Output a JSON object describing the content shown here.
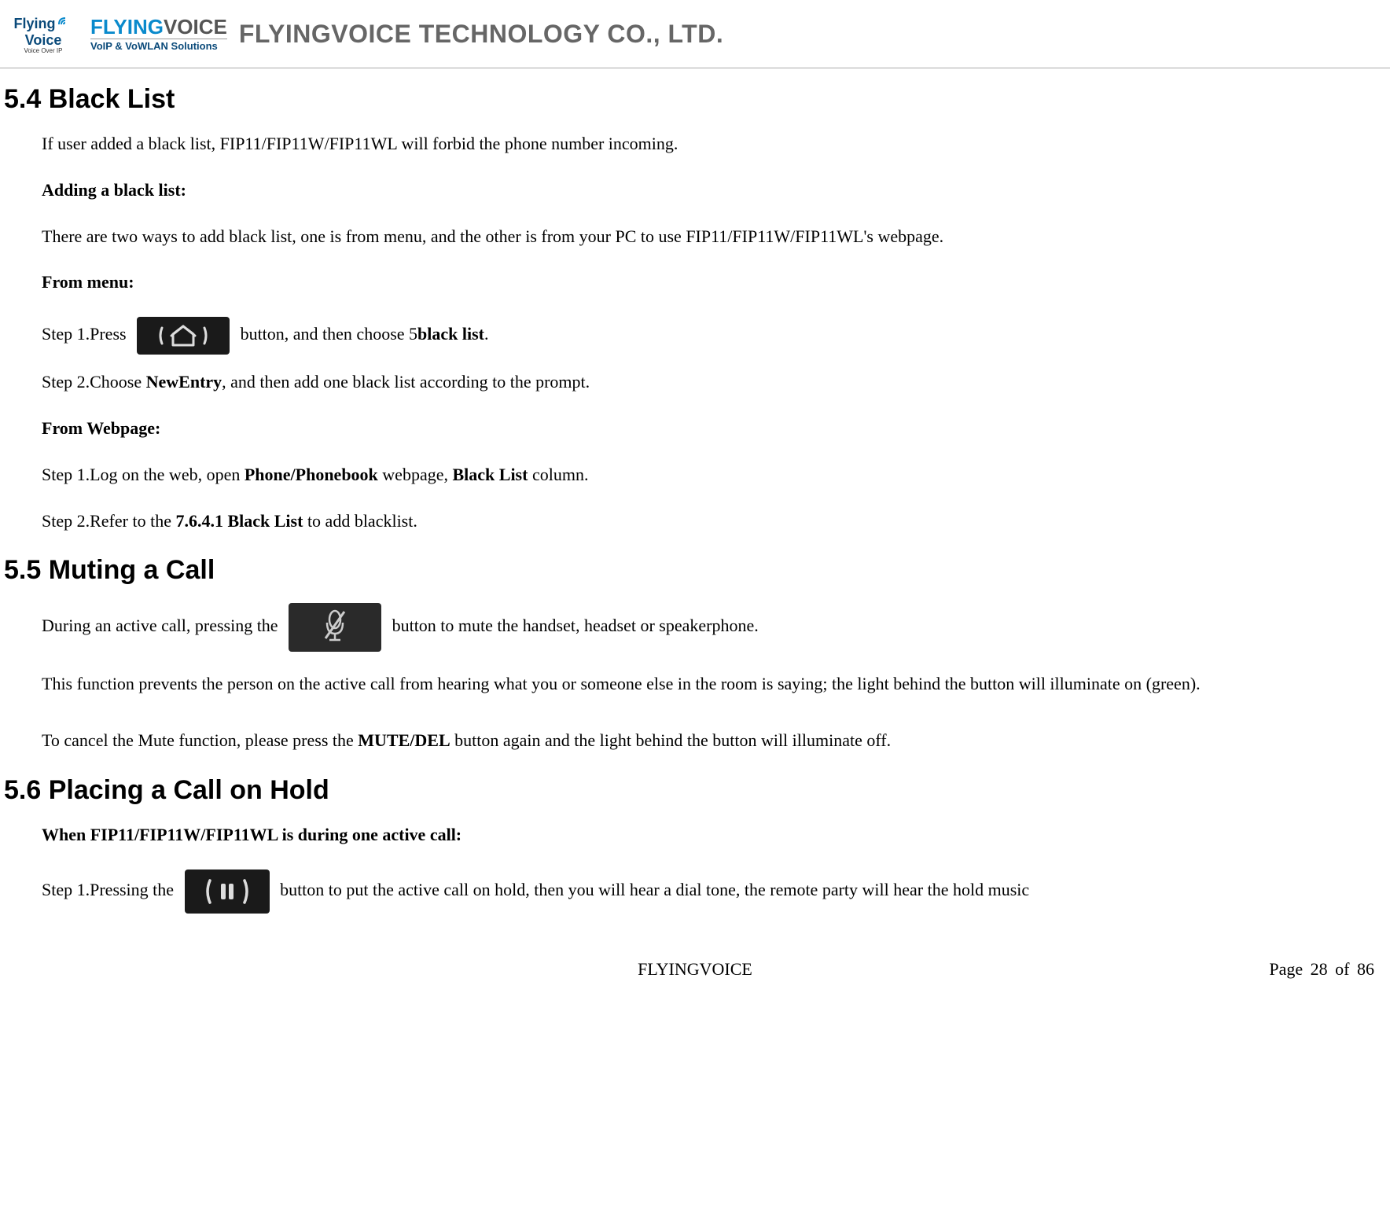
{
  "header": {
    "logo_small": {
      "line1": "Flying",
      "line2": "Voice",
      "tag": "Voice Over IP"
    },
    "logo_main": {
      "part1": "FLYING",
      "part2": "VOICE",
      "sub": "VoIP & VoWLAN Solutions"
    },
    "company": "FLYINGVOICE TECHNOLOGY CO., LTD."
  },
  "s54": {
    "title": "5.4   Black List",
    "p1": "If user added a black list, FIP11/FIP11W/FIP11WL will forbid the phone number incoming.",
    "p2": "Adding a black list:",
    "p3": "There are two ways to add black list, one is from menu, and the other is from your PC to use FIP11/FIP11W/FIP11WL's webpage.",
    "p4": "From menu:",
    "step1_a": "Step 1.Press ",
    "step1_b": " button, and then choose 5",
    "step1_c": "black list",
    "step1_d": ".",
    "step2_a": "Step 2.Choose ",
    "step2_b": "NewEntry",
    "step2_c": ", and then add one black list according to the prompt.",
    "p7": "From Webpage:",
    "web_s1_a": "Step 1.Log on the web, open ",
    "web_s1_b": "Phone/Phonebook",
    "web_s1_c": " webpage, ",
    "web_s1_d": "Black List",
    "web_s1_e": " column.",
    "web_s2_a": "Step 2.Refer to the ",
    "web_s2_b": "7.6.4.1 Black List",
    "web_s2_c": " to add blacklist."
  },
  "s55": {
    "title": "5.5   Muting a Call",
    "p1_a": "During an active call, pressing the ",
    "p1_b": " button to mute the handset, headset or speakerphone.",
    "p2": "This function prevents the person on the active call from hearing what you or someone else in the room is saying; the light behind the button will illuminate on (green).",
    "p3_a": "To cancel the Mute function, please press the ",
    "p3_b": "MUTE/DEL",
    "p3_c": " button again and the light behind the button will illuminate off."
  },
  "s56": {
    "title": "5.6   Placing a Call on Hold",
    "p1": "When FIP11/FIP11W/FIP11WL is during one active call:",
    "s1_a": "Step 1.Pressing the ",
    "s1_b": " button to put the active call on hold, then you will hear a dial tone, the remote party will hear the hold music"
  },
  "footer": {
    "center": "FLYINGVOICE",
    "right": "Page  28  of  86"
  }
}
